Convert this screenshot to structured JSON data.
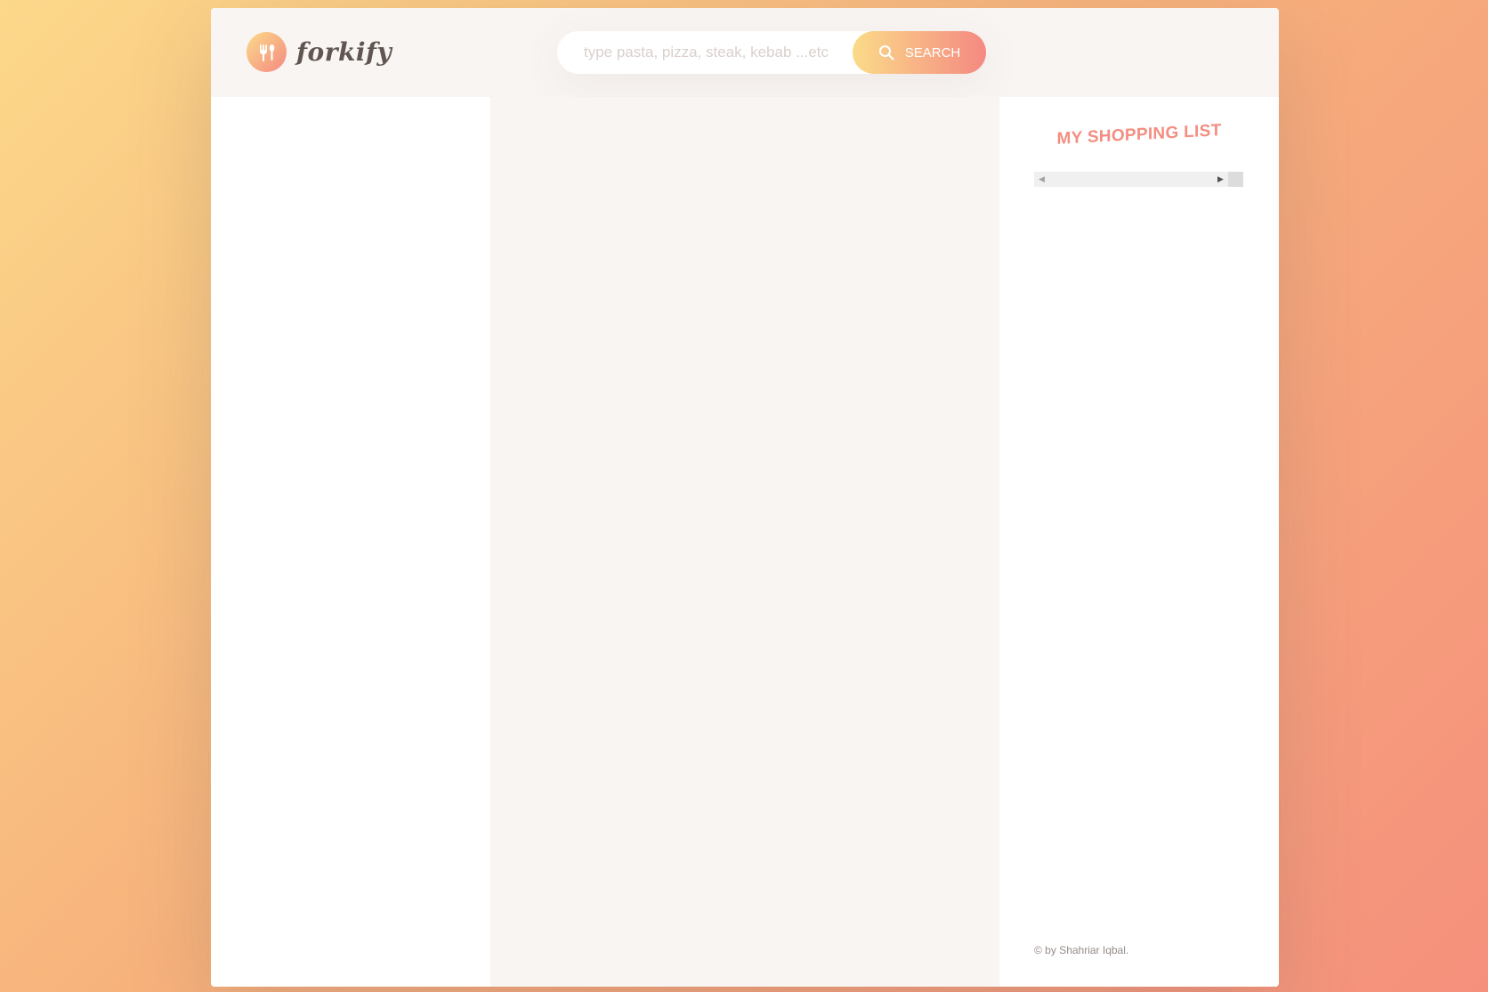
{
  "app": {
    "logo_text": "forkify",
    "logo_icon": "fork-spoon-icon"
  },
  "search": {
    "placeholder": "type pasta, pizza, steak, kebab ...etc",
    "value": "",
    "button_label": "SEARCH",
    "button_icon": "search-icon"
  },
  "shopping": {
    "title": "MY SHOPPING LIST",
    "scroll_left_icon": "caret-left-icon",
    "scroll_right_icon": "caret-right-icon"
  },
  "footer": {
    "copyright": "© by Shahriar Iqbal."
  },
  "colors": {
    "gradient_start": "#fbdb89",
    "gradient_end": "#f48982",
    "accent": "#f38e82",
    "text": "#615551",
    "panel_bg": "#f9f5f3"
  }
}
